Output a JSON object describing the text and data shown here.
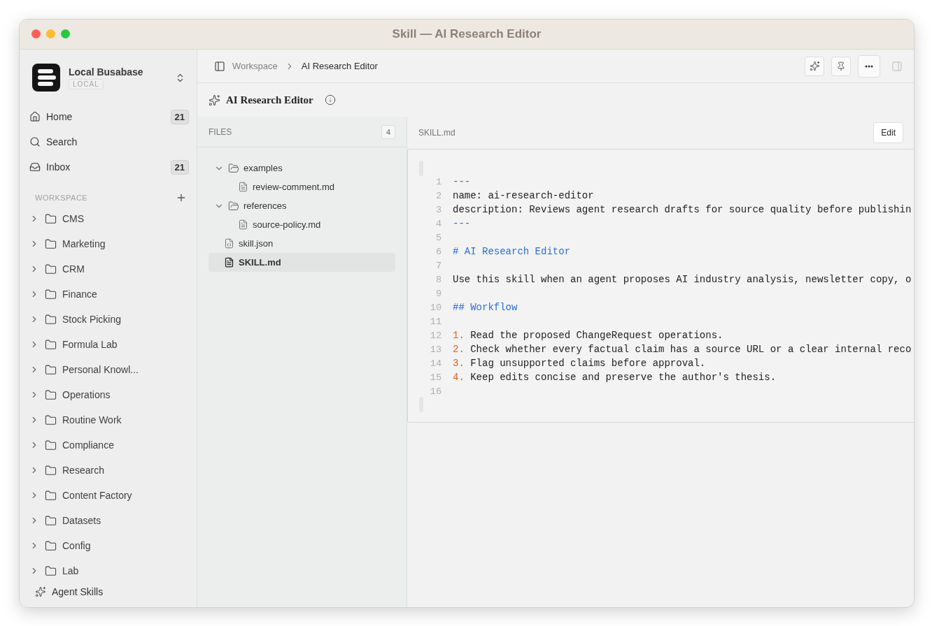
{
  "window": {
    "title": "Skill — AI Research Editor"
  },
  "workspace": {
    "name": "Local Busabase",
    "badge": "LOCAL"
  },
  "nav": [
    {
      "label": "Home",
      "count": "21"
    },
    {
      "label": "Search"
    },
    {
      "label": "Inbox",
      "count": "21"
    }
  ],
  "section": {
    "label": "WORKSPACE"
  },
  "folders": [
    {
      "label": "CMS",
      "expanded": false
    },
    {
      "label": "Marketing",
      "expanded": false
    },
    {
      "label": "CRM",
      "expanded": false
    },
    {
      "label": "Finance",
      "expanded": false
    },
    {
      "label": "Stock Picking",
      "expanded": false
    },
    {
      "label": "Formula Lab",
      "expanded": false
    },
    {
      "label": "Personal Knowl...",
      "expanded": false
    },
    {
      "label": "Operations",
      "expanded": false
    },
    {
      "label": "Routine Work",
      "expanded": false
    },
    {
      "label": "Compliance",
      "expanded": false
    },
    {
      "label": "Research",
      "expanded": false
    },
    {
      "label": "Content Factory",
      "expanded": false
    },
    {
      "label": "Datasets",
      "expanded": false
    },
    {
      "label": "Config",
      "expanded": false
    },
    {
      "label": "Lab",
      "expanded": false
    }
  ],
  "footer": {
    "label": "Agent Skills"
  },
  "breadcrumb": [
    "Workspace",
    "AI Research Editor"
  ],
  "page": {
    "title": "AI Research Editor"
  },
  "files": {
    "header": "FILES",
    "count": "4",
    "tree": [
      {
        "name": "examples",
        "kind": "folder",
        "expanded": true,
        "children": [
          {
            "name": "review-comment.md",
            "kind": "markdown",
            "selected": false
          }
        ]
      },
      {
        "name": "references",
        "kind": "folder",
        "expanded": true,
        "children": [
          {
            "name": "source-policy.md",
            "kind": "markdown",
            "selected": false
          }
        ]
      },
      {
        "name": "skill.json",
        "kind": "json",
        "selected": false
      },
      {
        "name": "SKILL.md",
        "kind": "markdown",
        "selected": true
      }
    ]
  },
  "editor": {
    "filename": "SKILL.md",
    "button": "Edit",
    "lines": [
      {
        "number": "1",
        "kind": "frontmatter",
        "text": "---"
      },
      {
        "number": "2",
        "kind": "text",
        "text": "name: ai-research-editor"
      },
      {
        "number": "3",
        "kind": "text",
        "text": "description: Reviews agent research drafts for source quality before publishin"
      },
      {
        "number": "4",
        "kind": "frontmatter",
        "text": "---"
      },
      {
        "number": "5",
        "kind": "blank"
      },
      {
        "number": "6",
        "kind": "heading",
        "text": "# AI Research Editor"
      },
      {
        "number": "7",
        "kind": "blank"
      },
      {
        "number": "8",
        "kind": "text",
        "text": "Use this skill when an agent proposes AI industry analysis, newsletter copy, o"
      },
      {
        "number": "9",
        "kind": "blank"
      },
      {
        "number": "10",
        "kind": "heading",
        "text": "## Workflow"
      },
      {
        "number": "11",
        "kind": "blank"
      },
      {
        "number": "12",
        "kind": "list",
        "marker": "1.",
        "text": "Read the proposed ChangeRequest operations."
      },
      {
        "number": "13",
        "kind": "list",
        "marker": "2.",
        "text": "Check whether every factual claim has a source URL or a clear internal reco"
      },
      {
        "number": "14",
        "kind": "list",
        "marker": "3.",
        "text": "Flag unsupported claims before approval."
      },
      {
        "number": "15",
        "kind": "list",
        "marker": "4.",
        "text": "Keep edits concise and preserve the author's thesis."
      },
      {
        "number": "16",
        "kind": "blank"
      }
    ]
  }
}
